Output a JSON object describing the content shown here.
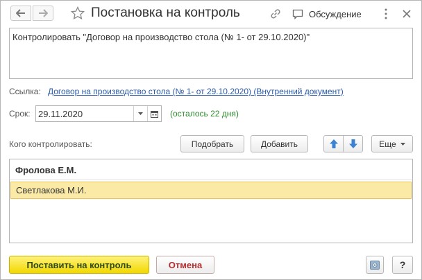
{
  "window": {
    "title": "Постановка на контроль",
    "discussion_label": "Обсуждение"
  },
  "description": "Контролировать \"Договор на производство стола (№ 1- от 29.10.2020)\"",
  "reference": {
    "label": "Ссылка:",
    "link_text": "Договор на производство стола (№ 1- от 29.10.2020) (Внутренний документ)"
  },
  "deadline": {
    "label": "Срок:",
    "value": "29.11.2020",
    "remaining": "(осталось 22 дня)"
  },
  "controllers": {
    "label": "Кого контролировать:",
    "pick_button": "Подобрать",
    "add_button": "Добавить",
    "more_button": "Еще",
    "header": "Фролова Е.М.",
    "rows": [
      "Светлакова М.И."
    ]
  },
  "footer": {
    "submit_button": "Поставить на контроль",
    "cancel_button": "Отмена",
    "help_button": "?"
  },
  "colors": {
    "link": "#2a5aa8",
    "remaining": "#2c8a2c",
    "submit_bg": "#f2d800",
    "selected_row": "#fbeaa5",
    "arrow_blue": "#3b82d0"
  },
  "icons": [
    "arrow-left-icon",
    "arrow-right-icon",
    "star-icon",
    "link-icon",
    "chat-icon",
    "more-vertical-icon",
    "close-icon",
    "chevron-down-icon",
    "calendar-icon",
    "arrow-up-icon",
    "arrow-down-icon",
    "camera-icon"
  ]
}
